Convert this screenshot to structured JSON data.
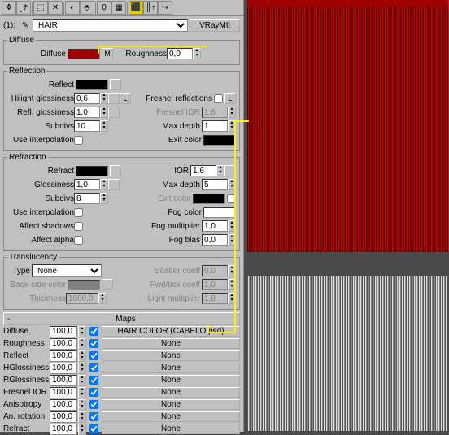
{
  "header": {
    "id": "(1):",
    "icon": "✎",
    "material_name": "HAIR",
    "type_btn": "VRayMtl"
  },
  "diffuse": {
    "title": "Diffuse",
    "diffuse_label": "Diffuse",
    "diffuse_color": "#a00000",
    "m_btn": "M",
    "roughness_label": "Roughness",
    "roughness": "0,0"
  },
  "reflection": {
    "title": "Reflection",
    "reflect_label": "Reflect",
    "hilight_label": "Hilight glossiness",
    "hilight": "0,6",
    "l_btn": "L",
    "reflg_label": "Refl. glossiness",
    "reflg": "1,0",
    "subdivs_label": "Subdivs",
    "subdivs": "10",
    "useint_label": "Use interpolation",
    "fresnel_label": "Fresnel reflections",
    "fresnelior_label": "Fresnel IOR",
    "fresnelior": "1,6",
    "maxdepth_label": "Max depth",
    "maxdepth": "1",
    "exitcolor_label": "Exit color"
  },
  "refraction": {
    "title": "Refraction",
    "refract_label": "Refract",
    "gloss_label": "Glossiness",
    "gloss": "1,0",
    "subdivs_label": "Subdivs",
    "subdivs": "8",
    "useint_label": "Use interpolation",
    "affshad_label": "Affect shadows",
    "affalpha_label": "Affect alpha",
    "ior_label": "IOR",
    "ior": "1,6",
    "maxdepth_label": "Max depth",
    "maxdepth": "5",
    "exitcolor_label": "Exit color",
    "fogcolor_label": "Fog color",
    "fogmult_label": "Fog multiplier",
    "fogmult": "1,0",
    "fogbias_label": "Fog bias",
    "fogbias": "0,0"
  },
  "translucency": {
    "title": "Translucency",
    "type_label": "Type",
    "type": "None",
    "back_label": "Back-side color",
    "thick_label": "Thickness",
    "thick": "1000,0",
    "scatter_label": "Scatter coeff",
    "scatter": "0,0",
    "fwd_label": "Fwd/bck coeff",
    "fwd": "1,0",
    "light_label": "Light multiplier",
    "light": "1,0"
  },
  "maps": {
    "title": "Maps",
    "sign": "-",
    "rows": [
      {
        "label": "Diffuse",
        "amount": "100,0",
        "on": true,
        "slot": "HAIR COLOR (CABELO.psd)"
      },
      {
        "label": "Roughness",
        "amount": "100,0",
        "on": true,
        "slot": "None"
      },
      {
        "label": "Reflect",
        "amount": "100,0",
        "on": true,
        "slot": "None"
      },
      {
        "label": "HGlossiness",
        "amount": "100,0",
        "on": true,
        "slot": "None"
      },
      {
        "label": "RGlossiness",
        "amount": "100,0",
        "on": true,
        "slot": "None"
      },
      {
        "label": "Fresnel IOR",
        "amount": "100,0",
        "on": true,
        "slot": "None"
      },
      {
        "label": "Anisotropy",
        "amount": "100,0",
        "on": true,
        "slot": "None"
      },
      {
        "label": "An. rotation",
        "amount": "100,0",
        "on": true,
        "slot": "None"
      },
      {
        "label": "Refract",
        "amount": "100,0",
        "on": true,
        "slot": "None"
      }
    ]
  }
}
